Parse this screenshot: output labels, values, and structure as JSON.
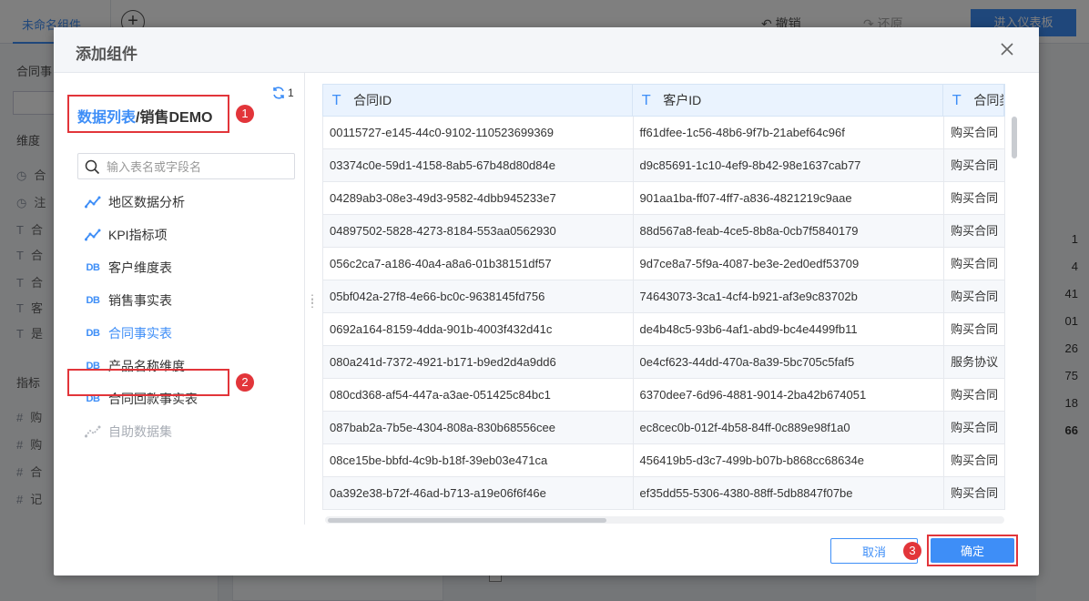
{
  "background": {
    "tab_label": "未命名组件",
    "undo_label": "撤销",
    "redo_label": "还原",
    "enter_dashboard_label": "进入仪表板",
    "dataset_label": "合同事",
    "dimension_label": "维度",
    "metric_label": "指标",
    "dimension_fields": [
      "合",
      "注",
      "合",
      "合",
      "合",
      "客",
      "是"
    ],
    "metric_fields": [
      "购",
      "购",
      "合",
      "记"
    ],
    "right_numbers": [
      "1",
      "4",
      "41",
      "01",
      "26",
      "75",
      "18",
      "66"
    ]
  },
  "dialog": {
    "title": "添加组件",
    "breadcrumb": {
      "root": "数据列表",
      "separator": "/",
      "current": "销售DEMO"
    },
    "refresh_count": "1",
    "search_placeholder": "输入表名或字段名",
    "tables": [
      {
        "label": "地区数据分析",
        "icon": "analysis-icon"
      },
      {
        "label": "KPI指标项",
        "icon": "analysis-icon"
      },
      {
        "label": "客户维度表",
        "icon": "db-table-icon"
      },
      {
        "label": "销售事实表",
        "icon": "db-table-icon"
      },
      {
        "label": "合同事实表",
        "icon": "db-table-icon"
      },
      {
        "label": "产品名称维度",
        "icon": "db-table-icon"
      },
      {
        "label": "合同回款事实表",
        "icon": "db-table-icon"
      },
      {
        "label": "自助数据集",
        "icon": "self-dataset-icon"
      }
    ],
    "selected_table": "合同事实表",
    "badges": [
      "1",
      "2",
      "3"
    ],
    "grid": {
      "columns": [
        "合同ID",
        "客户ID",
        "合同类"
      ],
      "rows": [
        [
          "00115727-e145-44c0-9102-110523699369",
          "ff61dfee-1c56-48b6-9f7b-21abef64c96f",
          "购买合同"
        ],
        [
          "03374c0e-59d1-4158-8ab5-67b48d80d84e",
          "d9c85691-1c10-4ef9-8b42-98e1637cab77",
          "购买合同"
        ],
        [
          "04289ab3-08e3-49d3-9582-4dbb945233e7",
          "901aa1ba-ff07-4ff7-a836-4821219c9aae",
          "购买合同"
        ],
        [
          "04897502-5828-4273-8184-553aa0562930",
          "88d567a8-feab-4ce5-8b8a-0cb7f5840179",
          "购买合同"
        ],
        [
          "056c2ca7-a186-40a4-a8a6-01b38151df57",
          "9d7ce8a7-5f9a-4087-be3e-2ed0edf53709",
          "购买合同"
        ],
        [
          "05bf042a-27f8-4e66-bc0c-9638145fd756",
          "74643073-3ca1-4cf4-b921-af3e9c83702b",
          "购买合同"
        ],
        [
          "0692a164-8159-4dda-901b-4003f432d41c",
          "de4b48c5-93b6-4af1-abd9-bc4e4499fb11",
          "购买合同"
        ],
        [
          "080a241d-7372-4921-b171-b9ed2d4a9dd6",
          "0e4cf623-44dd-470a-8a39-5bc705c5faf5",
          "服务协议"
        ],
        [
          "080cd368-af54-447a-a3ae-051425c84bc1",
          "6370dee7-6d96-4881-9014-2ba42b674051",
          "购买合同"
        ],
        [
          "087bab2a-7b5e-4304-808a-830b68556cee",
          "ec8cec0b-012f-4b58-84ff-0c889e98f1a0",
          "购买合同"
        ],
        [
          "08ce15be-bbfd-4c9b-b18f-39eb03e471ca",
          "456419b5-d3c7-499b-b07b-b868cc68634e",
          "购买合同"
        ],
        [
          "0a392e38-b72f-46ad-b713-a19e06f6f46e",
          "ef35dd55-5306-4380-88ff-5db8847f07be",
          "购买合同"
        ]
      ]
    },
    "cancel_label": "取消",
    "confirm_label": "确定"
  },
  "colors": {
    "accent": "#3e8ef7",
    "highlight_red": "#e2353a"
  }
}
